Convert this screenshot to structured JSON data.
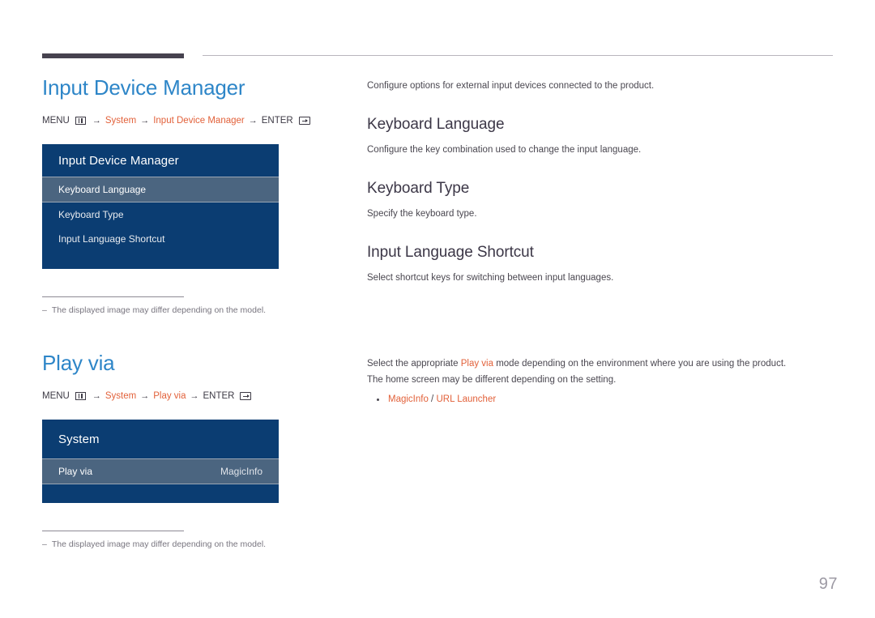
{
  "page": {
    "number": "97"
  },
  "sections": {
    "input_device_manager": {
      "title": "Input Device Manager",
      "breadcrumb": {
        "menu_label": "MENU",
        "menu_icon": "menu-grid-icon",
        "arrow": "→",
        "path1": "System",
        "path2": "Input Device Manager",
        "enter_label": "ENTER",
        "enter_icon": "enter-key-icon"
      },
      "osd": {
        "header": "Input Device Manager",
        "rows": [
          {
            "label": "Keyboard Language",
            "value": "",
            "selected": true
          },
          {
            "label": "Keyboard Type",
            "value": "",
            "selected": false
          },
          {
            "label": "Input Language Shortcut",
            "value": "",
            "selected": false
          }
        ]
      },
      "footnote": {
        "dash": "–",
        "text": "The displayed image may differ depending on the model."
      },
      "right": {
        "lead": "Configure options for external input devices connected to the product.",
        "subsections": [
          {
            "heading": "Keyboard Language",
            "description": "Configure the key combination used to change the input language."
          },
          {
            "heading": "Keyboard Type",
            "description": "Specify the keyboard type."
          },
          {
            "heading": "Input Language Shortcut",
            "description": "Select shortcut keys for switching between input languages."
          }
        ]
      }
    },
    "play_via": {
      "title": "Play via",
      "breadcrumb": {
        "menu_label": "MENU",
        "menu_icon": "menu-grid-icon",
        "arrow": "→",
        "path1": "System",
        "path2": "Play via",
        "enter_label": "ENTER",
        "enter_icon": "enter-key-icon"
      },
      "osd": {
        "header": "System",
        "rows": [
          {
            "label": "Play via",
            "value": "MagicInfo",
            "selected": true
          }
        ]
      },
      "footnote": {
        "dash": "–",
        "text": "The displayed image may differ depending on the model."
      },
      "right": {
        "para_part1": "Select the appropriate ",
        "para_highlight": "Play via",
        "para_part2": " mode depending on the environment where you are using the product.",
        "para_line2": "The home screen may be different depending on the setting.",
        "bullet_option1": "MagicInfo",
        "bullet_separator": " / ",
        "bullet_option2": "URL Launcher"
      }
    }
  },
  "colors": {
    "title_blue": "#2e86c8",
    "accent_orange": "#e2613a",
    "osd_navy": "#0b3d72",
    "osd_selected": "#4b6580",
    "rule_dark": "#46424f"
  }
}
